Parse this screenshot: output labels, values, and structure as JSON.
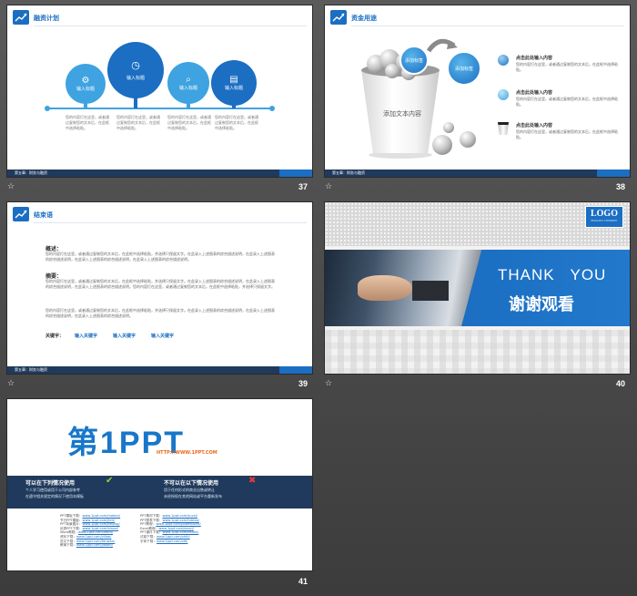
{
  "slides": [
    {
      "number": "37",
      "title": "融资计划",
      "footer": "第五章：财务与融资",
      "circles": [
        {
          "label": "输入标题",
          "icon": "gear-icon"
        },
        {
          "label": "输入标题",
          "icon": "clock-icon"
        },
        {
          "label": "输入标题",
          "icon": "magnifier-icon"
        },
        {
          "label": "输入标题",
          "icon": "document-icon"
        }
      ],
      "descriptions": [
        "您的内容打在这里，或者通过复制您的文本后，在此框中选择粘贴。",
        "您的内容打在这里，或者通过复制您的文本后，在此框中选择粘贴。",
        "您的内容打在这里，或者通过复制您的文本后，在此框中选择粘贴。",
        "您的内容打在这里，或者通过复制您的文本后，在此框中选择粘贴。"
      ]
    },
    {
      "number": "38",
      "title": "资金用途",
      "footer": "第五章：财务与融资",
      "bubble1": "添加标签",
      "bubble2": "添加标签",
      "cup_text": "添加文本内容",
      "items": [
        {
          "title": "点击此处输入内容",
          "desc": "您的内容打在这里，或者通过复制您的文本后，在此框中选择粘贴。"
        },
        {
          "title": "点击此处输入内容",
          "desc": "您的内容打在这里，或者通过复制您的文本后，在此框中选择粘贴。"
        },
        {
          "title": "点击此处输入内容",
          "desc": "您的内容打在这里，或者通过复制您的文本后，在此框中选择粘贴。"
        }
      ]
    },
    {
      "number": "39",
      "title": "结束语",
      "footer": "第五章：财务与融资",
      "overview_label": "概述：",
      "overview_text": "您的内容打在这里，或者通过复制您的文本后，在此框中选择粘贴，并选择只保留文字。在此录入上述图表的综合描述说明，在此录入上述图表的综合描述说明，在此录入上述图表的综合描述说明，在此录入上述图表的综合描述说明。",
      "summary_label": "摘要：",
      "summary_text": "您的内容打在这里，或者通过复制您的文本后，在此框中选择粘贴，并选择只保留文字。在此录入上述图表的综合描述说明，在此录入上述图表的综合描述说明，在此录入上述图表的综合描述说明。您的内容打在这里，或者通过复制您的文本后，在此框中选择粘贴，并选择只保留文字。",
      "extra_text": "您的内容打在这里，或者通过复制您的文本后，在此框中选择粘贴，并选择只保留文字。在此录入上述图表的综合描述说明，在此录入上述图表的综合描述说明，在此录入上述图表的综合描述说明。",
      "keywords_label": "关键字：",
      "keywords": [
        "输入关键字",
        "输入关键字",
        "输入关键字"
      ]
    },
    {
      "number": "40",
      "logo": "LOGO",
      "logo_sub": "ENGLISH COMPANY",
      "thank": "THANK   YOU",
      "chinese": "谢谢观看"
    },
    {
      "number": "41",
      "brand_main": "第1PPT",
      "brand_url": "HTTP://WWW.1PPT.COM",
      "can_title": "可以在下列情况使用",
      "can_items": [
        "个人学习使用或用于公司内部参考",
        "在遵守相关规定的情况下使用本模板"
      ],
      "cannot_title": "不可以在以下情况使用",
      "cannot_items": [
        "用于任何形式的商业出售或转让",
        "未经授权在其他网站或平台重新发布"
      ],
      "links_left": [
        {
          "name": "PPT模板下载：",
          "url": "www.1ppt.com/moban/"
        },
        {
          "name": "节日PPT模板：",
          "url": "www.1ppt.com/jieri/"
        },
        {
          "name": "PPT背景图片：",
          "url": "www.1ppt.com/beijing/"
        },
        {
          "name": "优秀PPT下载：",
          "url": "www.1ppt.com/xiazai/"
        },
        {
          "name": "Word教程：",
          "url": "www.1ppt.com/word/"
        },
        {
          "name": "资料下载：",
          "url": "www.1ppt.com/ziliao/"
        },
        {
          "name": "范文下载：",
          "url": "www.1ppt.com/fanwen/"
        },
        {
          "name": "教案下载：",
          "url": "www.1ppt.com/jiaoan/"
        }
      ],
      "links_right": [
        {
          "name": "PPT素材下载：",
          "url": "www.1ppt.com/sucai/"
        },
        {
          "name": "PPT图表下载：",
          "url": "www.1ppt.com/tubiao/"
        },
        {
          "name": "PPT教程：",
          "url": "www.1ppt.com/powerpoint/"
        },
        {
          "name": "Excel教程：",
          "url": "www.1ppt.com/excel/"
        },
        {
          "name": "PPT课件下载：",
          "url": "www.1ppt.com/kejian/"
        },
        {
          "name": "试卷下载：",
          "url": "www.1ppt.com/shiti/"
        },
        {
          "name": "字体下载：",
          "url": "www.1ppt.com/ziti/"
        }
      ]
    }
  ],
  "colors": {
    "accent": "#1b6ec2",
    "accent_light": "#3ea3e0",
    "navy": "#1f3a5c",
    "brand_orange": "#e86a1c",
    "brand_blue": "#1877c9"
  }
}
